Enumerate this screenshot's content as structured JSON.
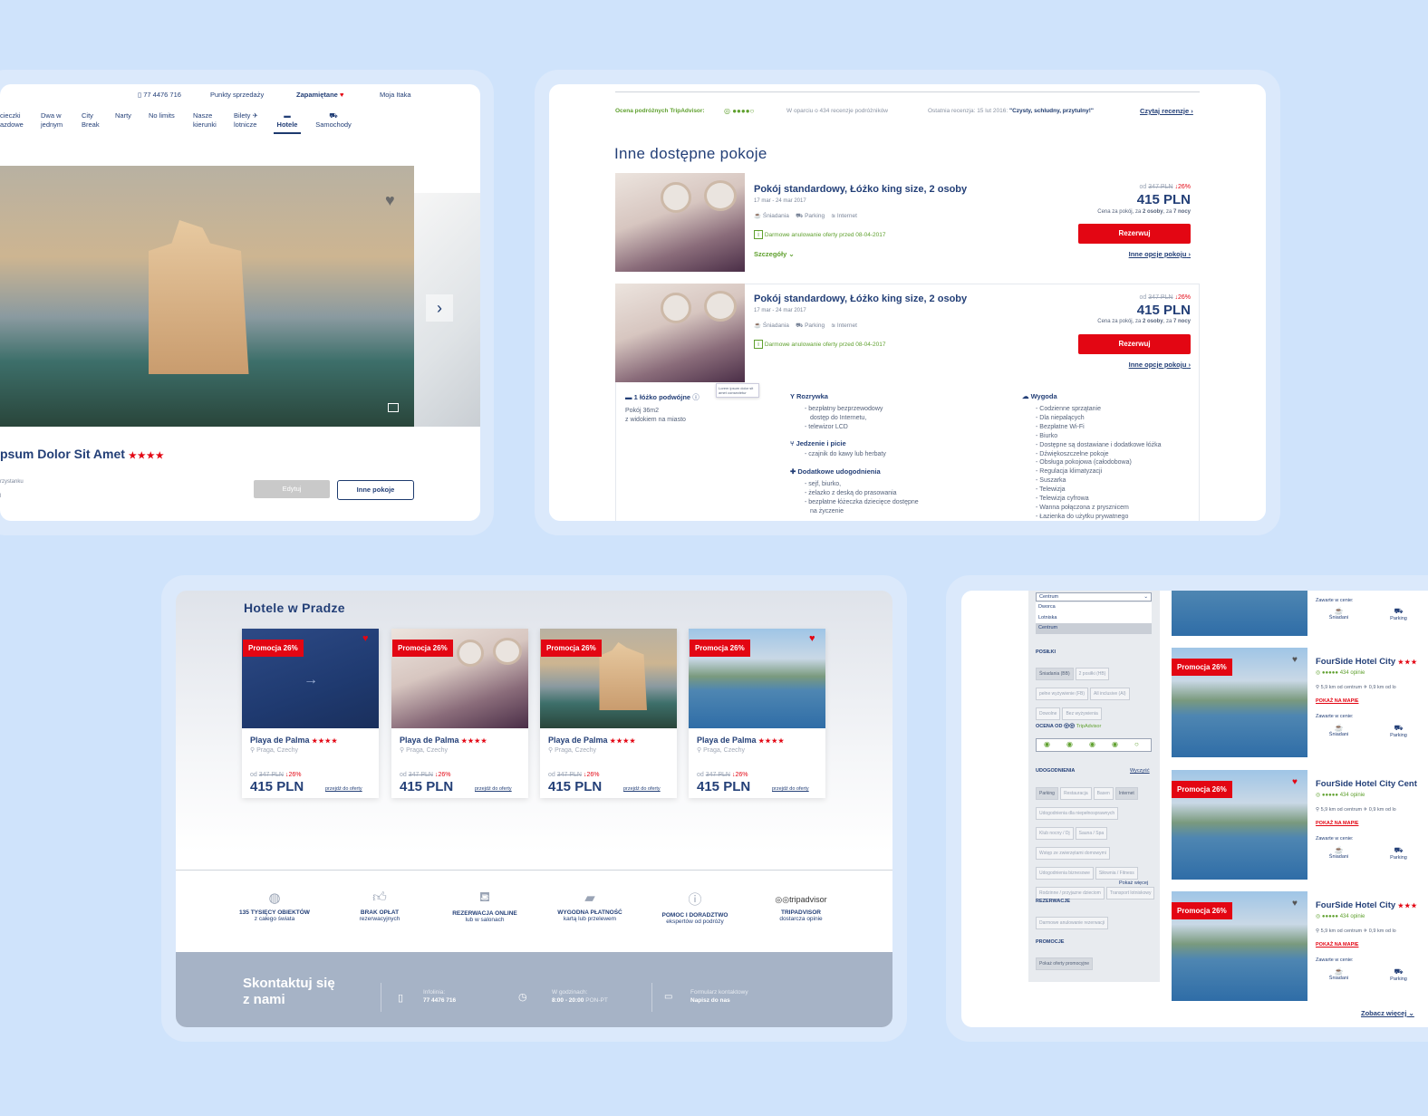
{
  "colors": {
    "bg": "#cfe3fb",
    "brand_navy": "#1d3a6e",
    "brand_red": "#e30613",
    "green": "#5fa02e"
  },
  "card1": {
    "phone": "77 4476 716",
    "topnav": [
      "Punkty sprzedaży",
      "Zapamiętane",
      "Moja Itaka"
    ],
    "menu": [
      {
        "l1": "cieczki",
        "l2": "azdowe"
      },
      {
        "l1": "Dwa w",
        "l2": "jednym"
      },
      {
        "l1": "City",
        "l2": "Break"
      },
      {
        "l1": "",
        "l2": "Narty"
      },
      {
        "l1": "",
        "l2": "No limits"
      },
      {
        "l1": "Nasze",
        "l2": "kierunki"
      },
      {
        "l1": "Bilety",
        "l2": "lotnicze"
      },
      {
        "l1": "",
        "l2": "Hotele"
      },
      {
        "l1": "",
        "l2": "Samochody"
      }
    ],
    "hotel_name": "psum Dolor Sit Amet",
    "stars": "★★★★",
    "sub1": "rzystanku",
    "sub2": "l",
    "edit_btn": "Edytuj",
    "rooms_btn": "Inne pokoje"
  },
  "card2": {
    "ta_label": "Ocena podróżnych TripAdvisor:",
    "ta_based": "W oparciu o 434 recenzje podróżników",
    "ta_last": "Ostatnia recenzja: 15 lut 2016:",
    "ta_quote": "\"Czysty, schludny, przytulny!\"",
    "ta_read": "Czytaj recenzje",
    "section_title": "Inne dostępne pokoje",
    "rooms": [
      {
        "title": "Pokój standardowy, Łóżko king size, 2 osoby",
        "dates": "17 mar - 24 mar 2017",
        "f1": "Śniadania",
        "f2": "Parking",
        "f3": "Internet",
        "cancel": "Darmowe anulowanie oferty przed 08-04-2017",
        "details": "Szczegóły",
        "from": "od",
        "old": "347 PLN",
        "disc": "↓26%",
        "price": "415 PLN",
        "note1": "Cena za pokój, za",
        "note2": "2 osoby",
        "note3": ", za",
        "note4": "7 nocy",
        "btn": "Rezerwuj",
        "more": "Inne opcje pokoju"
      },
      {
        "title": "Pokój standardowy, Łóżko king size, 2 osoby",
        "dates": "17 mar - 24 mar 2017",
        "f1": "Śniadania",
        "f2": "Parking",
        "f3": "Internet",
        "cancel": "Darmowe anulowanie oferty przed 08-04-2017",
        "details": "",
        "from": "od",
        "old": "347 PLN",
        "disc": "↓26%",
        "price": "415 PLN",
        "note1": "Cena za pokój, za",
        "note2": "2 osoby",
        "note3": ", za",
        "note4": "7 nocy",
        "btn": "Rezerwuj",
        "more": "Inne opcje pokoju"
      }
    ],
    "bed": "1 łóżko podwójne",
    "tooltip": "Lorem ipsum dolor sit amet consectetur",
    "size": "Pokój 36m2",
    "view": "z widokiem na miasto",
    "ent_title": "Rozrywka",
    "ent": [
      "- bezpłatny bezprzewodowy",
      "dostęp do Internetu,",
      "- telewizor LCD"
    ],
    "food_title": "Jedzenie i picie",
    "food": [
      "- czajnik do kawy lub herbaty"
    ],
    "extra_title": "Dodatkowe udogodnienia",
    "extra": [
      "- sejf, biurko,",
      "- żelazko z deską do prasowania",
      "- bezpłatne łóżeczka dziecięce dostępne",
      "na życzenie"
    ],
    "conv_title": "Wygoda",
    "conv": [
      "- Codzienne sprzątanie",
      "- Dla niepalących",
      "- Bezpłatne Wi-Fi",
      "- Biurko",
      "- Dostępne są dostawiane i dodatkowe łóżka",
      "- Dźwiękoszczelne pokoje",
      "- Obsługa pokojowa (całodobowa)",
      "- Regulacja klimatyzacji",
      "- Suszarka",
      "- Telewizja",
      "- Telewizja cyfrowa",
      "- Wanna połączona z prysznicem",
      "- Łazienka do użytku prywatnego"
    ]
  },
  "card3": {
    "title": "Hotele w Pradze",
    "hotels": [
      {
        "promo": "Promocja 26%",
        "name": "Playa de Palma",
        "stars": "★★★★",
        "loc": "Praga, Czechy",
        "from": "od",
        "old": "347 PLN",
        "disc": "↓26%",
        "price": "415 PLN",
        "link": "przejdź do oferty"
      },
      {
        "promo": "Promocja 26%",
        "name": "Playa de Palma",
        "stars": "★★★★",
        "loc": "Praga, Czechy",
        "from": "od",
        "old": "347 PLN",
        "disc": "↓26%",
        "price": "415 PLN",
        "link": "przejdź do oferty"
      },
      {
        "promo": "Promocja 26%",
        "name": "Playa de Palma",
        "stars": "★★★★",
        "loc": "Praga, Czechy",
        "from": "od",
        "old": "347 PLN",
        "disc": "↓26%",
        "price": "415 PLN",
        "link": "przejdź do oferty"
      },
      {
        "promo": "Promocja 26%",
        "name": "Playa de Palma",
        "stars": "★★★★",
        "loc": "Praga, Czechy",
        "from": "od",
        "old": "347 PLN",
        "disc": "↓26%",
        "price": "415 PLN",
        "link": "przejdź do oferty"
      }
    ],
    "features": [
      {
        "l1": "135 TYSIĘCY OBIEKTÓW",
        "l2": "z całego świata"
      },
      {
        "l1": "BRAK OPŁAT",
        "l2": "rezerwacyjnych"
      },
      {
        "l1": "REZERWACJA ONLINE",
        "l2": "lub w salonach"
      },
      {
        "l1": "WYGODNA PŁATNOŚĆ",
        "l2": "kartą lub przelewem"
      },
      {
        "l1": "POMOC I DORADZTWO",
        "l2": "ekspertów od podróży"
      },
      {
        "l1": "TRIPADVISOR",
        "l2": "dostarcza opinie"
      }
    ],
    "ta_logo": "tripadvisor",
    "contact_l1": "Skontaktuj się",
    "contact_l2": "z nami",
    "info_label": "Infolinia:",
    "info_value": "77 4476 716",
    "hours_label": "W godzinach:",
    "hours_value": "8:00 - 20:00",
    "hours_days": "PON-PT",
    "form_label": "Formularz kontaktowy",
    "form_value": "Napisz do nas"
  },
  "card4": {
    "select_value": "Centrum",
    "select_options": [
      "Dworca",
      "Lotniska",
      "Centrum"
    ],
    "meals_title": "POSIŁKI",
    "meals": [
      "Śniadania (BB)",
      "2 posiłki (HB)",
      "pełne wyżywienie (FB)",
      "All inclusive (AI)",
      "Dowolne",
      "Bez wyżywienia"
    ],
    "rating_title": "OCENA OD",
    "rating_brand": "TripAdvisor",
    "amen_title": "UDOGODNIENIA",
    "clear": "Wyczyść",
    "amen": [
      "Parking",
      "Restauracja",
      "Basen",
      "Internet",
      "Udogodnienia dla niepełnosprawnych",
      "Klub nocny / Dj",
      "Sauna / Spa",
      "Wstęp ze zwierzętami domowymi",
      "Udogodnienia biznesowe",
      "Siłownia / Fitness",
      "Rodzinne / przyjazne dzieciom",
      "Transport lotniskowy"
    ],
    "show_more": "Pokaż więcej",
    "res_title": "REZERWACJE",
    "res": [
      "Darmowe anulowanie rezerwacji"
    ],
    "promo_title": "PROMOCJE",
    "promo": [
      "Pokaż oferty promocyjne"
    ],
    "included": "Zawarte w cenie:",
    "inc1": "Śniadani",
    "inc2": "Parking",
    "results": [
      {
        "promo": "Promocja 26%",
        "name": "FourSide Hotel City",
        "stars": "★★★",
        "reviews": "434 opinie",
        "dist1": "5,9 km od centrum",
        "dist2": "0,9 km od lo",
        "map": "POKAŻ NA MAPIE"
      },
      {
        "promo": "Promocja 26%",
        "name": "FourSide Hotel City Cent",
        "stars": "",
        "reviews": "434 opinie",
        "dist1": "5,9 km od centrum",
        "dist2": "0,9 km od lo",
        "map": "POKAŻ NA MAPIE"
      },
      {
        "promo": "Promocja 26%",
        "name": "FourSide Hotel City",
        "stars": "★★★",
        "reviews": "434 opinie",
        "dist1": "5,9 km od centrum",
        "dist2": "0,9 km od lo",
        "map": "POKAŻ NA MAPIE"
      }
    ],
    "see_more": "Zobacz więcej"
  }
}
